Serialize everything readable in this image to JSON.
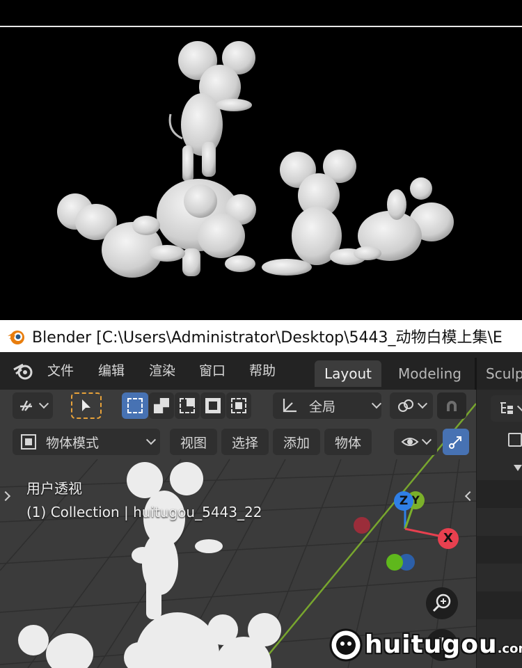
{
  "window": {
    "title": "Blender [C:\\Users\\Administrator\\Desktop\\5443_动物白模上集\\E"
  },
  "menu": {
    "items": [
      "文件",
      "编辑",
      "渲染",
      "窗口",
      "帮助"
    ]
  },
  "workspaces": {
    "tabs": [
      "Layout",
      "Modeling",
      "Sculp"
    ],
    "active": "Layout"
  },
  "viewport_header": {
    "transform_orientation": "全局",
    "mode": "物体模式",
    "menus": [
      "视图",
      "选择",
      "添加",
      "物体"
    ]
  },
  "viewport_overlay": {
    "view_name": "用户透视",
    "collection_info": "(1) Collection | huitugou_5443_22"
  },
  "gizmo": {
    "x_label": "X",
    "y_label": "Y",
    "z_label": "Z",
    "colors": {
      "x": "#e8404f",
      "y": "#7bb02a",
      "z": "#2f7fe6",
      "x_neg": "#9b2d3a",
      "y_neg": "#5fb81c",
      "z_neg": "#2c5fa8"
    }
  },
  "watermark": {
    "brand": "huitugou",
    "suffix": ".com"
  },
  "colors": {
    "accent_blue": "#4772b3",
    "select_tool_outline": "#e8a23a",
    "grid_y_axis": "#78a62e"
  },
  "icons": [
    "blender-logo",
    "cursor-tool",
    "select-arrow",
    "transform-orientation",
    "link",
    "snap-magnet",
    "object-mode",
    "visibility-eye",
    "overlay-gizmo",
    "zoom-icon",
    "hand-icon",
    "outliner"
  ]
}
